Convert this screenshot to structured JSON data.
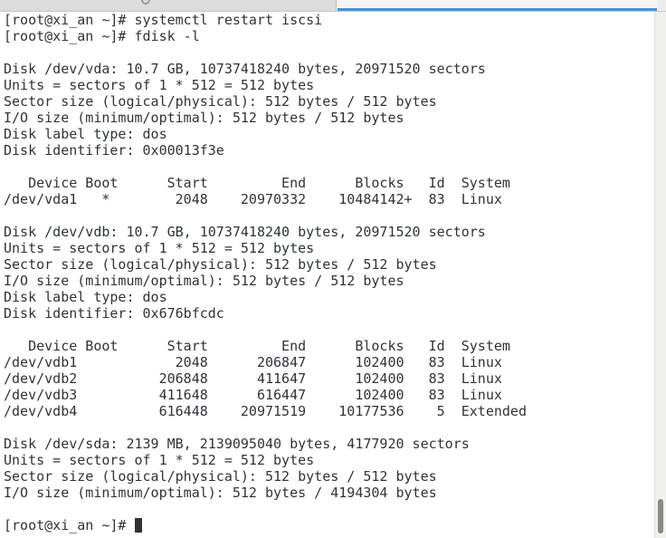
{
  "terminal": {
    "lines": [
      "[root@xi_an ~]# systemctl restart iscsi",
      "[root@xi_an ~]# fdisk -l",
      "",
      "Disk /dev/vda: 10.7 GB, 10737418240 bytes, 20971520 sectors",
      "Units = sectors of 1 * 512 = 512 bytes",
      "Sector size (logical/physical): 512 bytes / 512 bytes",
      "I/O size (minimum/optimal): 512 bytes / 512 bytes",
      "Disk label type: dos",
      "Disk identifier: 0x00013f3e",
      "",
      "   Device Boot      Start         End      Blocks   Id  System",
      "/dev/vda1   *        2048    20970332    10484142+  83  Linux",
      "",
      "Disk /dev/vdb: 10.7 GB, 10737418240 bytes, 20971520 sectors",
      "Units = sectors of 1 * 512 = 512 bytes",
      "Sector size (logical/physical): 512 bytes / 512 bytes",
      "I/O size (minimum/optimal): 512 bytes / 512 bytes",
      "Disk label type: dos",
      "Disk identifier: 0x676bfcdc",
      "",
      "   Device Boot      Start         End      Blocks   Id  System",
      "/dev/vdb1            2048      206847      102400   83  Linux",
      "/dev/vdb2          206848      411647      102400   83  Linux",
      "/dev/vdb3          411648      616447      102400   83  Linux",
      "/dev/vdb4          616448    20971519    10177536    5  Extended",
      "",
      "Disk /dev/sda: 2139 MB, 2139095040 bytes, 4177920 sectors",
      "Units = sectors of 1 * 512 = 512 bytes",
      "Sector size (logical/physical): 512 bytes / 512 bytes",
      "I/O size (minimum/optimal): 512 bytes / 4194304 bytes",
      ""
    ],
    "prompt": "[root@xi_an ~]# "
  },
  "icons": {
    "tab_1": "search-icon",
    "tab_2": "search-icon",
    "cursor": "block-cursor"
  },
  "colors": {
    "text": "#2e3436",
    "background": "#ffffff",
    "active_tab_accent": "#4a90d9"
  }
}
